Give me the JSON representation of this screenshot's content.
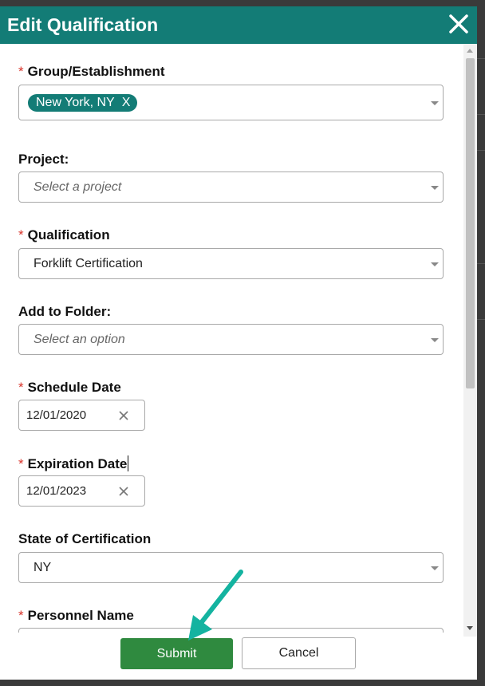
{
  "modal": {
    "title": "Edit Qualification",
    "close_icon": "close-icon"
  },
  "fields": {
    "group": {
      "required": "*",
      "label": "Group/Establishment",
      "tag_value": "New York, NY",
      "tag_remove": "X"
    },
    "project": {
      "label": "Project:",
      "placeholder": "Select a project"
    },
    "qualification": {
      "required": "*",
      "label": "Qualification",
      "value": "Forklift Certification"
    },
    "folder": {
      "label": "Add to Folder:",
      "placeholder": "Select an option"
    },
    "schedule_date": {
      "required": "*",
      "label": "Schedule Date",
      "value": "12/01/2020"
    },
    "expiration_date": {
      "required": "*",
      "label": "Expiration Date",
      "value": "12/01/2023"
    },
    "state": {
      "label": "State of Certification",
      "value": "NY"
    },
    "personnel": {
      "required": "*",
      "label": "Personnel Name"
    }
  },
  "footer": {
    "submit_label": "Submit",
    "cancel_label": "Cancel"
  },
  "colors": {
    "header": "#137c76",
    "tag": "#137c76",
    "submit": "#2f8a3f",
    "required": "#d9342b",
    "annotation_arrow": "#14b3a0"
  },
  "annotation": {
    "icon": "arrow-annotation-icon"
  }
}
